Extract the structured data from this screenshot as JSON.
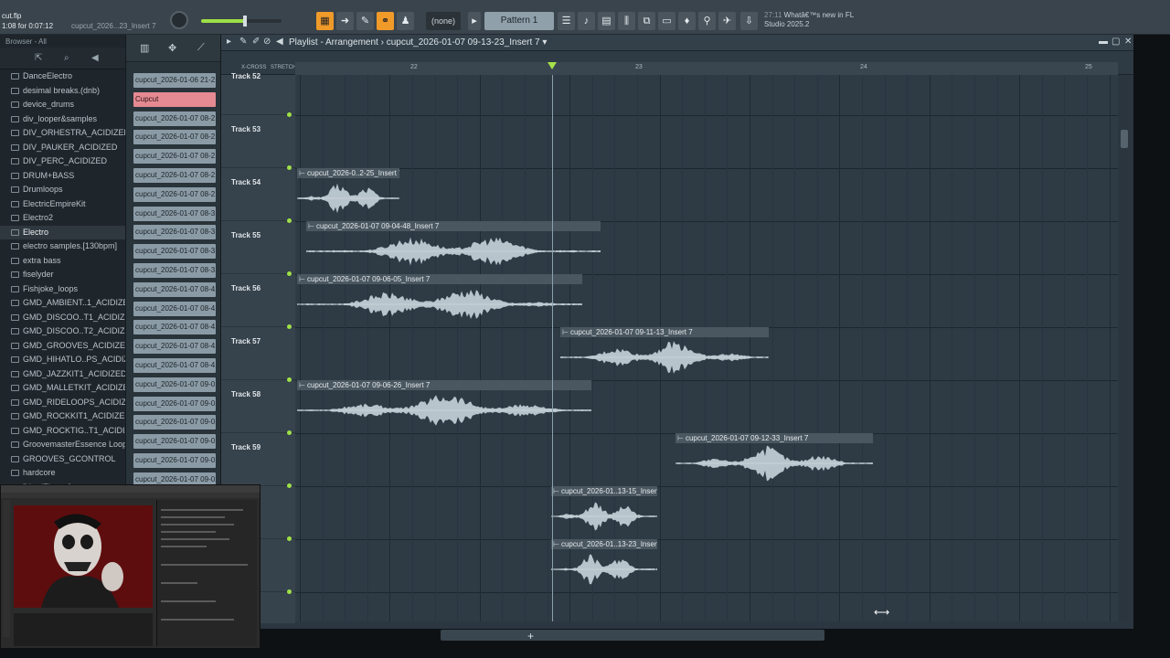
{
  "app": {
    "file": "cut.flp",
    "time_label": "1:08 for 0:07:12",
    "recent": "cupcut_2026...23_Insert 7"
  },
  "toolbar": {
    "pattern_select": "(none)",
    "pattern": "Pattern 1",
    "news_time": "27:11",
    "news_line1": "Whatâ€™s new in FL",
    "news_line2": "Studio 2025.2",
    "volume_level": 0.55
  },
  "browser": {
    "header": "Browser - All",
    "folders": [
      "DanceElectro",
      "desimal breaks.(dnb)",
      "device_drums",
      "div_looper&samples",
      "DIV_ORHESTRA_ACIDIZED",
      "DIV_PAUKER_ACIDIZED",
      "DIV_PERC_ACIDIZED",
      "DRUM+BASS",
      "Drumloops",
      "ElectricEmpireKit",
      "Electro2",
      "Electro",
      "electro samples.[130bpm]",
      "extra bass",
      "fiselyder",
      "Fishjoke_loops",
      "GMD_AMBIENT..1_ACIDIZED",
      "GMD_DISCOO..T1_ACIDIZED",
      "GMD_DISCOO..T2_ACIDIZED",
      "GMD_GROOVES_ACIDIZED",
      "GMD_HIHATLO..PS_ACIDIZED",
      "GMD_JAZZKIT1_ACIDIZED",
      "GMD_MALLETKIT_ACIDIZED",
      "GMD_RIDELOOPS_ACIDIZED",
      "GMD_ROCKKIT1_ACIDIZED",
      "GMD_ROCKTIG..T1_ACIDIZED",
      "GroovemasterEssence Loops",
      "GROOVES_GCONTROL",
      "hardcore",
      "[HardElectro]"
    ],
    "selected": "Electro"
  },
  "picker": {
    "clips": [
      "cupcut_2026-01-06 21-2..",
      "Cupcut",
      "cupcut_2026-01-07 08-2..",
      "cupcut_2026-01-07 08-2..",
      "cupcut_2026-01-07 08-2..",
      "cupcut_2026-01-07 08-2..",
      "cupcut_2026-01-07 08-2..",
      "cupcut_2026-01-07 08-3..",
      "cupcut_2026-01-07 08-3..",
      "cupcut_2026-01-07 08-3..",
      "cupcut_2026-01-07 08-3..",
      "cupcut_2026-01-07 08-4..",
      "cupcut_2026-01-07 08-4..",
      "cupcut_2026-01-07 08-4..",
      "cupcut_2026-01-07 08-4..",
      "cupcut_2026-01-07 08-4..",
      "cupcut_2026-01-07 09-0..",
      "cupcut_2026-01-07 09-0..",
      "cupcut_2026-01-07 09-0..",
      "cupcut_2026-01-07 09-0..",
      "cupcut_2026-01-07 09-0..",
      "cupcut_2026-01-07 09-0.."
    ]
  },
  "playlist": {
    "title": "Playlist - Arrangement",
    "breadcrumb": "cupcut_2026-01-07 09-13-23_Insert 7",
    "crossfade_label": "X-CROSS",
    "stretch_label": "STRETCH",
    "ruler": [
      "22",
      "23",
      "24",
      "25"
    ],
    "tracks": [
      "Track 52",
      "Track 53",
      "Track 54",
      "Track 55",
      "Track 56",
      "Track 57",
      "Track 58",
      "Track 59",
      "",
      ""
    ],
    "clips": [
      {
        "track": 2,
        "name": "cupcut_2026-0..2-25_Insert 7"
      },
      {
        "track": 3,
        "name": "cupcut_2026-01-07 09-04-48_Insert 7"
      },
      {
        "track": 4,
        "name": "cupcut_2026-01-07 09-06-05_Insert 7"
      },
      {
        "track": 5,
        "name": "cupcut_2026-01-07 09-11-13_Insert 7"
      },
      {
        "track": 6,
        "name": "cupcut_2026-01-07 09-06-26_Insert 7"
      },
      {
        "track": 7,
        "name": "cupcut_2026-01-07 09-12-33_Insert 7"
      },
      {
        "track": 8,
        "name": "cupcut_2026-01..13-15_Insert 7"
      },
      {
        "track": 9,
        "name": "cupcut_2026-01..13-23_Insert 7"
      }
    ]
  },
  "colors": {
    "accent": "#f09a2a",
    "green": "#9ee048",
    "clip": "#8b9ba6",
    "clip_selected": "#e58a92"
  }
}
